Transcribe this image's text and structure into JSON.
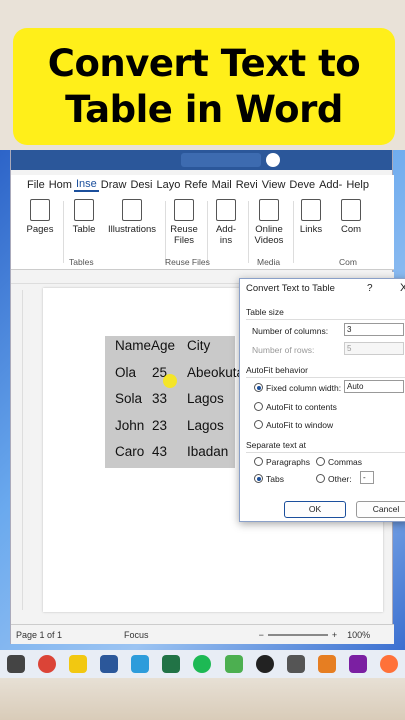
{
  "banner": {
    "line1": "Convert Text to",
    "line2": "Table in Word"
  },
  "word": {
    "tabs": [
      "File",
      "Hom",
      "Inse",
      "Draw",
      "Desi",
      "Layo",
      "Refe",
      "Mail",
      "Revi",
      "View",
      "Deve",
      "Add-",
      "Help"
    ],
    "ribbon": {
      "pages": "Pages",
      "table": "Table",
      "illustrations": "Illustrations",
      "reuse1": "Reuse",
      "reuse2": "Files",
      "addins1": "Add-",
      "addins2": "ins",
      "online1": "Online",
      "online2": "Videos",
      "links": "Links",
      "comment": "Com",
      "group_tables": "Tables",
      "group_reuse": "Reuse Files",
      "group_media": "Media",
      "group_com": "Com"
    },
    "document": {
      "rows": [
        [
          "Name",
          "Age",
          "City"
        ],
        [
          "Ola",
          "25",
          "Abeokuta"
        ],
        [
          "Sola",
          "33",
          "Lagos"
        ],
        [
          "John",
          "23",
          "Lagos"
        ],
        [
          "Caro",
          "43",
          "Ibadan"
        ]
      ]
    },
    "status": {
      "page": "Page 1 of 1",
      "focus": "Focus",
      "zoom": "100%",
      "minus": "−",
      "plus": "+"
    }
  },
  "dialog": {
    "title": "Convert Text to Table",
    "help": "?",
    "close": "X",
    "table_size": "Table size",
    "num_columns_label": "Number of columns:",
    "num_columns_value": "3",
    "num_rows_label": "Number of rows:",
    "num_rows_value": "5",
    "autofit_behavior": "AutoFit behavior",
    "fixed_width": "Fixed column width:",
    "fixed_width_value": "Auto",
    "autofit_contents": "AutoFit to contents",
    "autofit_window": "AutoFit to window",
    "separate_text": "Separate text at",
    "paragraphs": "Paragraphs",
    "commas": "Commas",
    "tabs": "Tabs",
    "other": "Other:",
    "other_value": "-",
    "ok": "OK",
    "cancel": "Cancel"
  }
}
